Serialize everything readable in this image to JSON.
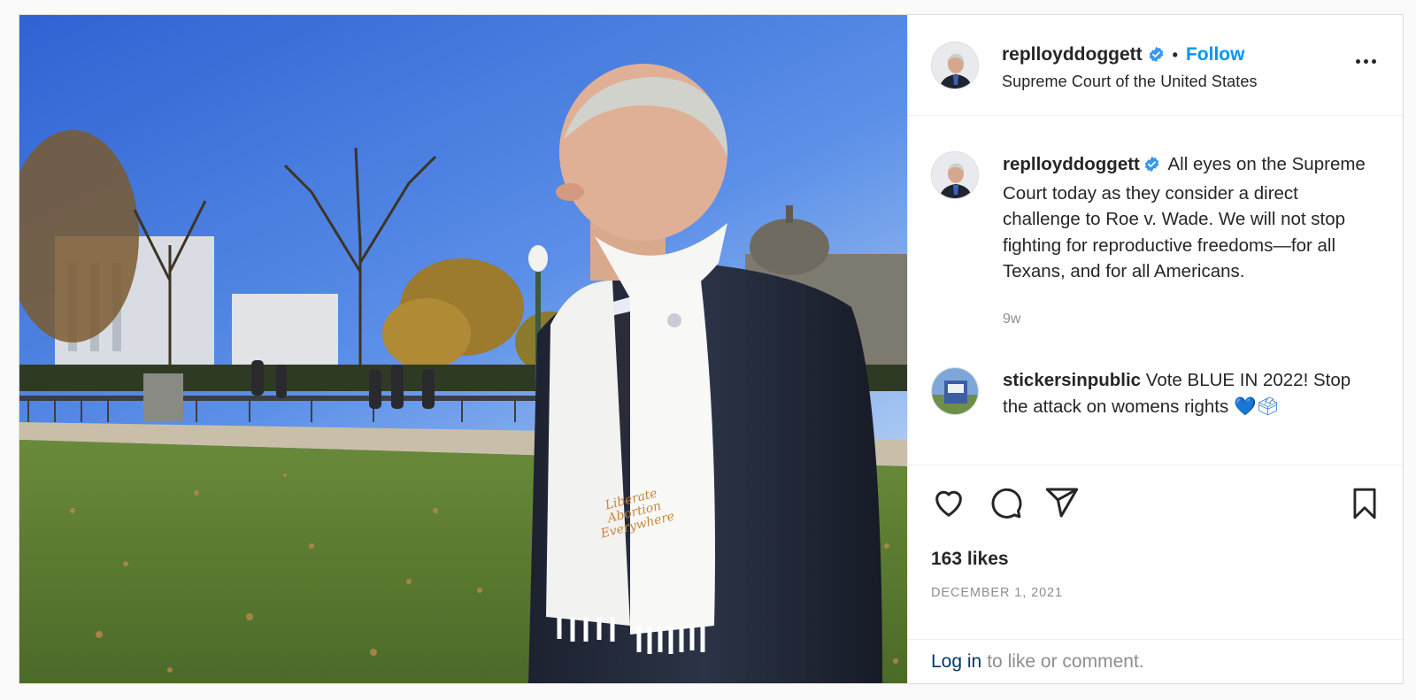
{
  "post": {
    "author": {
      "username": "replloyddoggett",
      "verified": true,
      "follow_label": "Follow",
      "separator": "•"
    },
    "location": "Supreme Court of the United States",
    "scarf_text": "Liberate Abortion Everywhere",
    "caption": {
      "username": "replloyddoggett",
      "text": "All eyes on the Supreme Court today as they consider a direct challenge to Roe v. Wade. We will not stop fighting for reproductive freedoms—for all Texans, and for all Americans.",
      "time": "9w"
    },
    "comments": [
      {
        "username": "stickersinpublic",
        "text": "Vote BLUE IN 2022! Stop the attack on womens rights",
        "emoji": "💙🗳"
      }
    ],
    "likes": "163 likes",
    "date": "DECEMBER 1, 2021",
    "login_link": "Log in",
    "login_text": "to like or comment."
  },
  "icons": [
    "heart-icon",
    "comment-icon",
    "share-icon",
    "bookmark-icon",
    "more-icon",
    "verified-badge-icon"
  ],
  "colors": {
    "link_blue": "#0095f6",
    "login_blue": "#00376b",
    "muted": "#8e8e8e",
    "text": "#262626"
  }
}
